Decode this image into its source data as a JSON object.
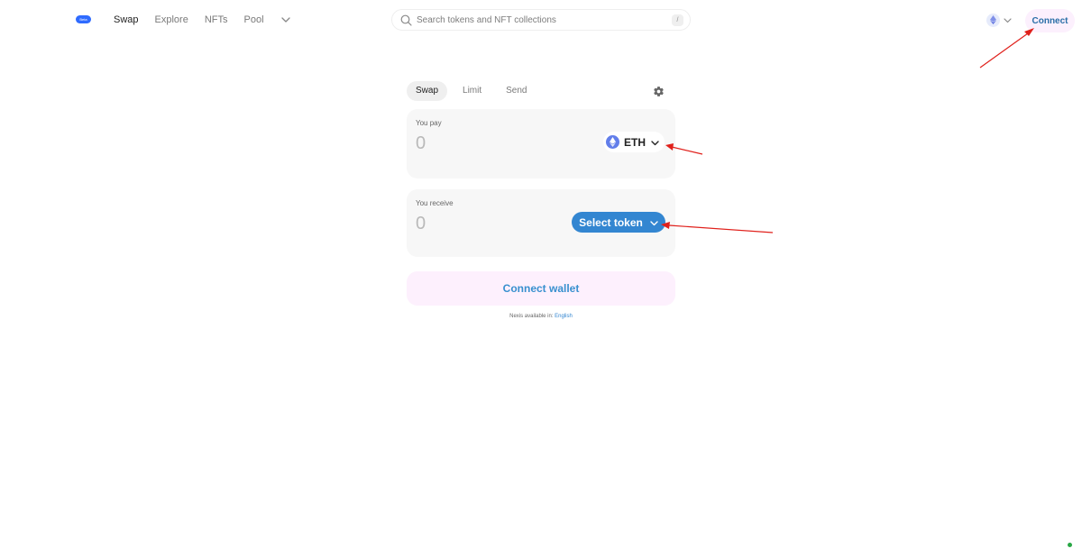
{
  "nav": {
    "logo_text": "Beta",
    "links": [
      {
        "label": "Swap",
        "active": true
      },
      {
        "label": "Explore",
        "active": false
      },
      {
        "label": "NFTs",
        "active": false
      },
      {
        "label": "Pool",
        "active": false
      }
    ],
    "search": {
      "placeholder": "Search tokens and NFT collections",
      "shortcut": "/"
    },
    "chain_icon": "ethereum-icon",
    "connect_label": "Connect"
  },
  "swap": {
    "tabs": [
      {
        "label": "Swap",
        "active": true
      },
      {
        "label": "Limit",
        "active": false
      },
      {
        "label": "Send",
        "active": false
      }
    ],
    "pay": {
      "label": "You pay",
      "placeholder": "0",
      "token": "ETH"
    },
    "receive": {
      "label": "You receive",
      "placeholder": "0",
      "token_button": "Select token"
    },
    "connect_wallet_label": "Connect wallet",
    "footer": {
      "text": "Nexis available in: ",
      "language": "English"
    }
  },
  "colors": {
    "accent": "#3386d1",
    "connect_bg": "#fdf0fd",
    "annotation_arrow": "#e0201b",
    "status": "#28a745"
  }
}
